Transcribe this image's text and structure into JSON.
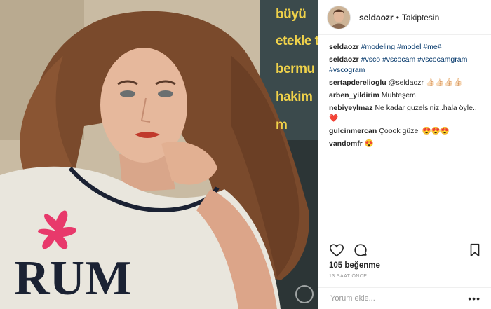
{
  "photo": {
    "description_icon": "photo-image",
    "magazine_words": [
      "büyü",
      "etekle t",
      "bermu",
      "hakim",
      "m"
    ]
  },
  "header": {
    "username": "seldaozr",
    "separator": "•",
    "follow_status": "Takiptesin"
  },
  "comments": [
    {
      "user": "seldaozr",
      "text": "#modeling #model #me#",
      "tag": true
    },
    {
      "user": "seldaozr",
      "text": "#vsco #vscocam #vscocamgram #vscogram",
      "tag": true
    },
    {
      "user": "sertapderelioglu",
      "text": "@seldaozr 👍🏻👍🏻👍🏻👍🏻",
      "tag": false
    },
    {
      "user": "arben_yildirim",
      "text": "Muhteşem",
      "tag": false
    },
    {
      "user": "nebiyeylmaz",
      "text": "Ne kadar guzelsiniz..hala öyle.. ❤️",
      "tag": false
    },
    {
      "user": "gulcinmercan",
      "text": "Çoook güzel 😍😍😍",
      "tag": false
    },
    {
      "user": "vandomfr",
      "text": "😍",
      "tag": false
    }
  ],
  "actions": {
    "like_icon": "heart-icon",
    "comment_icon": "comment-icon",
    "save_icon": "bookmark-icon"
  },
  "likes": "105 beğenme",
  "time": "13 SAAT ÖNCE",
  "add_comment": {
    "placeholder": "Yorum ekle...",
    "more": "•••"
  }
}
